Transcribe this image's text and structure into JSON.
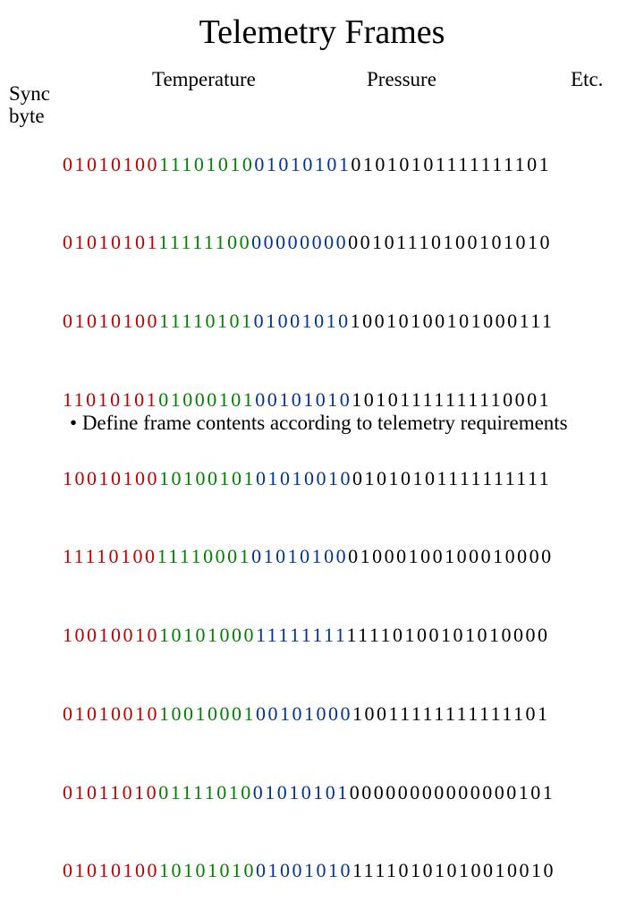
{
  "title": "Telemetry Frames",
  "labels": {
    "sync": "Sync\nbyte",
    "temperature": "Temperature",
    "pressure": "Pressure",
    "etc": "Etc."
  },
  "binary_rows": [
    {
      "sync": "01010100",
      "temp": "11101010",
      "press": "01010101",
      "etc": "01010101111111101"
    },
    {
      "sync": "01010101",
      "temp": "11111100",
      "press": "00000000",
      "etc": "00101110100101010"
    },
    {
      "sync": "01010100",
      "temp": "11110101",
      "press": "01001010",
      "etc": "10010100101000111"
    },
    {
      "sync": "11010101",
      "temp": "01000101",
      "press": "00101010",
      "etc": "10101111111110001"
    },
    {
      "sync": "10010100",
      "temp": "10100101",
      "press": "01010010",
      "etc": "01010101111111111"
    },
    {
      "sync": "11110100",
      "temp": "11110001",
      "press": "01010100",
      "etc": "01000100100010000"
    },
    {
      "sync": "10010010",
      "temp": "10101000",
      "press": "11111111",
      "etc": "11110100101010000"
    },
    {
      "sync": "01010010",
      "temp": "10010001",
      "press": "00101000",
      "etc": "10011111111111101"
    },
    {
      "sync": "01011010",
      "temp": "01111010",
      "press": "01010101",
      "etc": "00000000000000101"
    },
    {
      "sync": "01010100",
      "temp": "10101010",
      "press": "01001010",
      "etc": "11110101010010010"
    }
  ],
  "bullet": "Define frame contents according to telemetry requirements"
}
